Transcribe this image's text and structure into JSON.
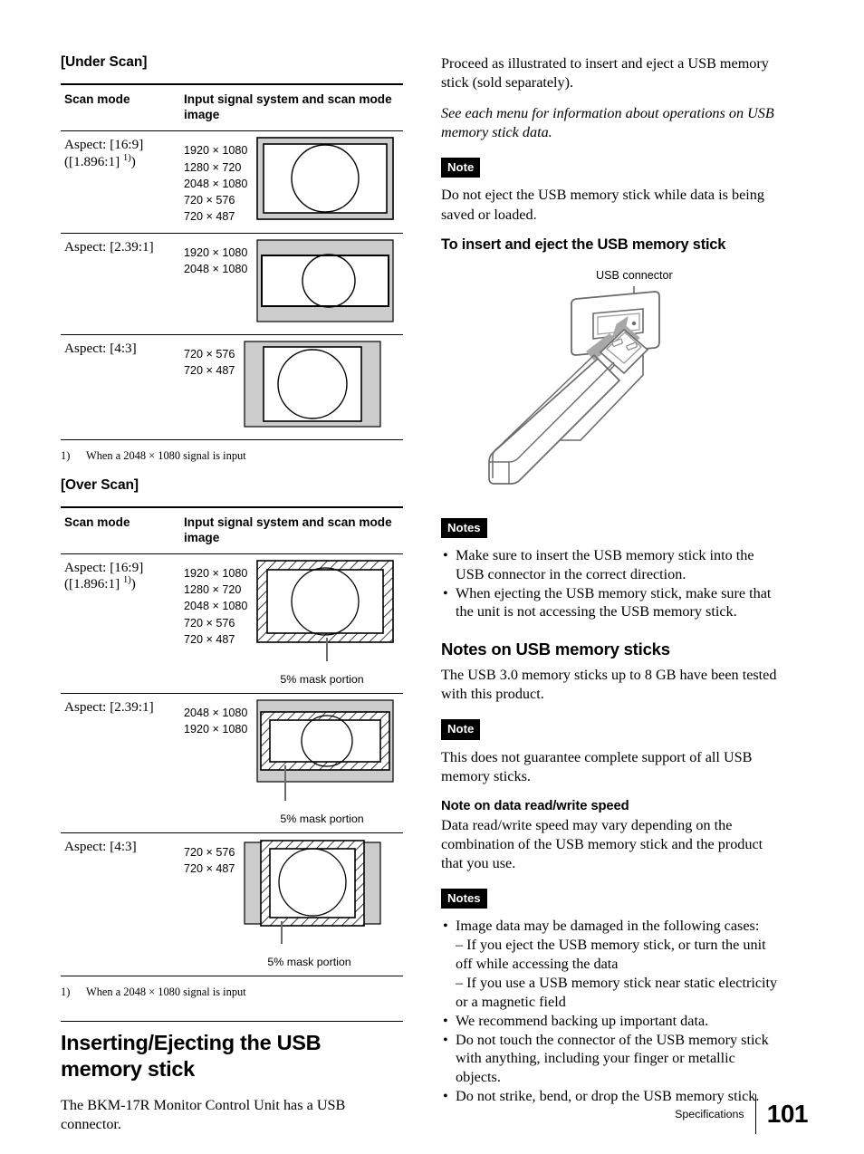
{
  "left": {
    "under_scan": {
      "section_label": "[Under Scan]",
      "headers": {
        "col1": "Scan mode",
        "col2": "Input signal system and scan mode image"
      },
      "rows": [
        {
          "mode_line1": "Aspect: [16:9]",
          "mode_line2_pre": "([1.896:1] ",
          "mode_footnote_marker": "1)",
          "mode_line2_post": ")",
          "signals": [
            "1920 × 1080",
            "1280 × 720",
            "2048 × 1080",
            "720 × 576",
            "720 × 487"
          ],
          "diagram": "full-16-9"
        },
        {
          "mode_line1": "Aspect: [2.39:1]",
          "mode_line2_pre": "",
          "mode_footnote_marker": "",
          "mode_line2_post": "",
          "signals": [
            "1920 × 1080",
            "2048 × 1080"
          ],
          "diagram": "letterbox"
        },
        {
          "mode_line1": "Aspect: [4:3]",
          "mode_line2_pre": "",
          "mode_footnote_marker": "",
          "mode_line2_post": "",
          "signals": [
            "720 × 576",
            "720 × 487"
          ],
          "diagram": "pillarbox"
        }
      ],
      "footnote_num": "1)",
      "footnote_text": "When a 2048 × 1080 signal is input"
    },
    "over_scan": {
      "section_label": "[Over Scan]",
      "headers": {
        "col1": "Scan mode",
        "col2": "Input signal system and scan mode image"
      },
      "rows": [
        {
          "mode_line1": "Aspect: [16:9]",
          "mode_line2_pre": "([1.896:1] ",
          "mode_footnote_marker": "1)",
          "mode_line2_post": ")",
          "signals": [
            "1920 × 1080",
            "1280 × 720",
            "2048 × 1080",
            "720 × 576",
            "720 × 487"
          ],
          "diagram": "mask-16-9",
          "mask_caption": "5% mask portion"
        },
        {
          "mode_line1": "Aspect: [2.39:1]",
          "mode_line2_pre": "",
          "mode_footnote_marker": "",
          "mode_line2_post": "",
          "signals": [
            "2048 × 1080",
            "1920 × 1080"
          ],
          "diagram": "mask-letterbox",
          "mask_caption": "5% mask portion"
        },
        {
          "mode_line1": "Aspect: [4:3]",
          "mode_line2_pre": "",
          "mode_footnote_marker": "",
          "mode_line2_post": "",
          "signals": [
            "720 × 576",
            "720 × 487"
          ],
          "diagram": "mask-pillarbox",
          "mask_caption": "5% mask portion"
        }
      ],
      "footnote_num": "1)",
      "footnote_text": "When a 2048 × 1080 signal is input"
    },
    "chapter_heading": "Inserting/Ejecting the USB memory stick",
    "chapter_intro": "The BKM-17R Monitor Control Unit has a USB connector."
  },
  "right": {
    "intro": "Proceed as illustrated to insert and eject a USB memory stick (sold separately).",
    "intro_italic": "See each menu for information about operations on USB memory stick data.",
    "note_badge_1": "Note",
    "note_1_text": "Do not eject the USB memory stick while data is being saved or loaded.",
    "insert_heading": "To insert and eject the USB memory stick",
    "usb_connector_label": "USB connector",
    "notes_badge_1": "Notes",
    "notes_1": [
      "Make sure to insert the USB memory stick into the USB connector in the correct direction.",
      "When ejecting the USB memory stick, make sure that the unit is not accessing the USB memory stick."
    ],
    "notes_heading": "Notes on USB memory sticks",
    "notes_intro": "The USB 3.0 memory sticks up to 8 GB have been tested with this product.",
    "note_badge_2": "Note",
    "note_2_text": "This does not guarantee complete support of all USB memory sticks.",
    "speed_heading": "Note on data read/write speed",
    "speed_text": "Data read/write speed may vary depending on the combination of the USB memory stick and the product that you use.",
    "notes_badge_2": "Notes",
    "notes_2": [
      {
        "main": "Image data may be damaged in the following cases:",
        "subs": [
          "– If you eject the USB memory stick, or turn the unit off while accessing the data",
          "– If you use a USB memory stick near static electricity or a magnetic field"
        ]
      },
      {
        "main": "We recommend backing up important data.",
        "subs": []
      },
      {
        "main": "Do not touch the connector of the USB memory stick with anything, including your finger or metallic objects.",
        "subs": []
      },
      {
        "main": "Do not strike, bend, or drop the USB memory stick.",
        "subs": []
      }
    ]
  },
  "footer": {
    "chapter": "Specifications",
    "page_number": "101"
  },
  "colors": {
    "text": "#000000",
    "badge_bg": "#000000",
    "badge_fg": "#ffffff",
    "mask_gray": "#cccccc",
    "illustration_line": "#6b6b6b"
  }
}
